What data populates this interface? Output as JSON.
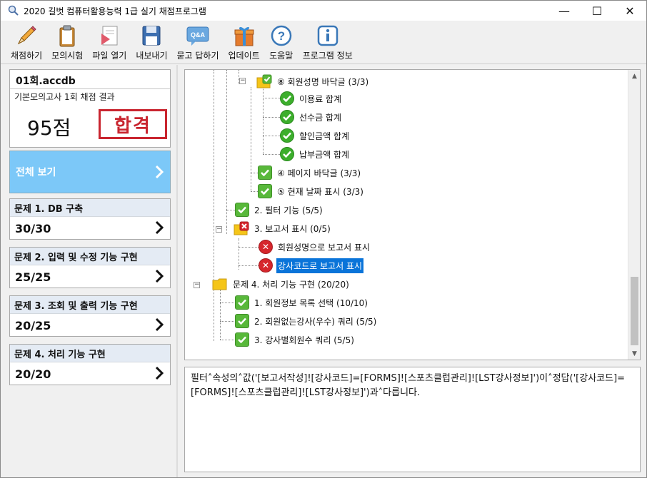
{
  "window": {
    "title": "2020 길벗 컴퓨터활용능력 1급 실기 채점프로그램",
    "minimize": "—",
    "maximize": "☐",
    "close": "✕"
  },
  "toolbar": [
    {
      "label": "채점하기",
      "icon": "pencil-icon"
    },
    {
      "label": "모의시험",
      "icon": "clipboard-icon"
    },
    {
      "label": "파일 열기",
      "icon": "open-file-icon"
    },
    {
      "label": "내보내기",
      "icon": "floppy-disk-icon"
    },
    {
      "label": "묻고 답하기",
      "icon": "qa-bubble-icon",
      "badge": "Q&A"
    },
    {
      "label": "업데이트",
      "icon": "gift-icon"
    },
    {
      "label": "도움말",
      "icon": "help-icon"
    },
    {
      "label": "프로그램 정보",
      "icon": "info-icon"
    }
  ],
  "result": {
    "file": "01회.accdb",
    "subtitle": "기본모의고사 1회 채점 결과",
    "score": "95점",
    "pass": "합격"
  },
  "all_view_label": "전체 보기",
  "questions": [
    {
      "title": "문제 1. DB 구축",
      "score": "30/30"
    },
    {
      "title": "문제 2. 입력 및 수정 기능 구현",
      "score": "25/25"
    },
    {
      "title": "문제 3. 조회 및 출력 기능 구현",
      "score": "20/25"
    },
    {
      "title": "문제 4. 처리 기능 구현",
      "score": "20/20"
    }
  ],
  "tree": {
    "n1": "⑧ 회원성명 바닥글 (3/3)",
    "n2": "이용료 합계",
    "n3": "선수금 합계",
    "n4": "할인금액 합계",
    "n5": "납부금액 합계",
    "n6": "④ 페이지 바닥글 (3/3)",
    "n7": "⑤ 현재 날짜 표시 (3/3)",
    "n8": "2. 필터 기능 (5/5)",
    "n9": "3. 보고서 표시 (0/5)",
    "n10": "회원성명으로 보고서 표시",
    "n11": "강사코드로 보고서 표시",
    "n12": "문제 4. 처리 기능 구현 (20/20)",
    "n13": "1. 회원정보 목록 선택 (10/10)",
    "n14": "2. 회원없는강사(우수) 쿼리 (5/5)",
    "n15": "3. 강사별회원수 쿼리 (5/5)"
  },
  "detail_text": "필터˄속성의˄값('[보고서작성]![강사코드]=[FORMS]![스포츠클럽관리]![LST강사정보]')이˄정답('[강사코드]=[FORMS]![스포츠클럽관리]![LST강사정보]')과˄다릅니다.",
  "colors": {
    "accent": "#7cc8f8",
    "selected": "#0a74d9",
    "pass": "#c9252f",
    "ok": "#3cae2c",
    "fail": "#d6262c"
  }
}
